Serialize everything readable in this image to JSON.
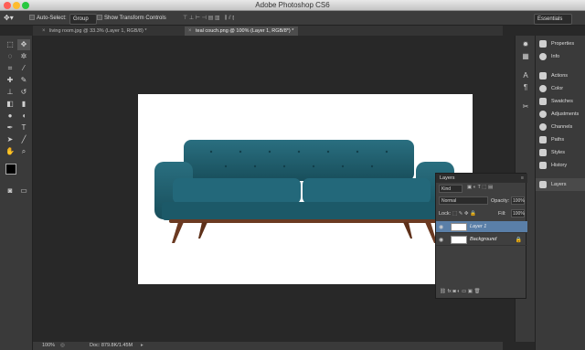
{
  "window": {
    "title": "Adobe Photoshop CS6"
  },
  "options_bar": {
    "auto_select_label": "Auto-Select:",
    "auto_select_value": "Group",
    "show_transform_label": "Show Transform Controls",
    "workspace": "Essentials"
  },
  "tabs": [
    {
      "label": "living room.jpg @ 33.3% (Layer 1, RGB/8) *",
      "active": false
    },
    {
      "label": "teal couch.png @ 100% (Layer 1, RGB/8*) *",
      "active": true
    }
  ],
  "status": {
    "zoom": "100%",
    "doc": "Doc: 879.8K/1.45M"
  },
  "right_panels": [
    {
      "label": "Properties",
      "icon": "properties-icon"
    },
    {
      "label": "Info",
      "icon": "info-icon"
    },
    {
      "label": "Actions",
      "icon": "actions-icon"
    },
    {
      "label": "Color",
      "icon": "color-icon"
    },
    {
      "label": "Swatches",
      "icon": "swatches-icon"
    },
    {
      "label": "Adjustments",
      "icon": "adjustments-icon"
    },
    {
      "label": "Channels",
      "icon": "channels-icon"
    },
    {
      "label": "Paths",
      "icon": "paths-icon"
    },
    {
      "label": "Styles",
      "icon": "styles-icon"
    },
    {
      "label": "History",
      "icon": "history-icon"
    },
    {
      "label": "Layers",
      "icon": "layers-icon"
    }
  ],
  "layers_panel": {
    "title": "Layers",
    "filter": "Kind",
    "blend_mode": "Normal",
    "opacity_label": "Opacity:",
    "opacity_value": "100%",
    "lock_label": "Lock:",
    "fill_label": "Fill:",
    "fill_value": "100%",
    "layers": [
      {
        "name": "Layer 1",
        "selected": true
      },
      {
        "name": "Background",
        "selected": false
      }
    ]
  },
  "colors": {
    "couch": "#1f5c6b",
    "legs": "#6b3a22",
    "selection": "#5a7fa8"
  }
}
